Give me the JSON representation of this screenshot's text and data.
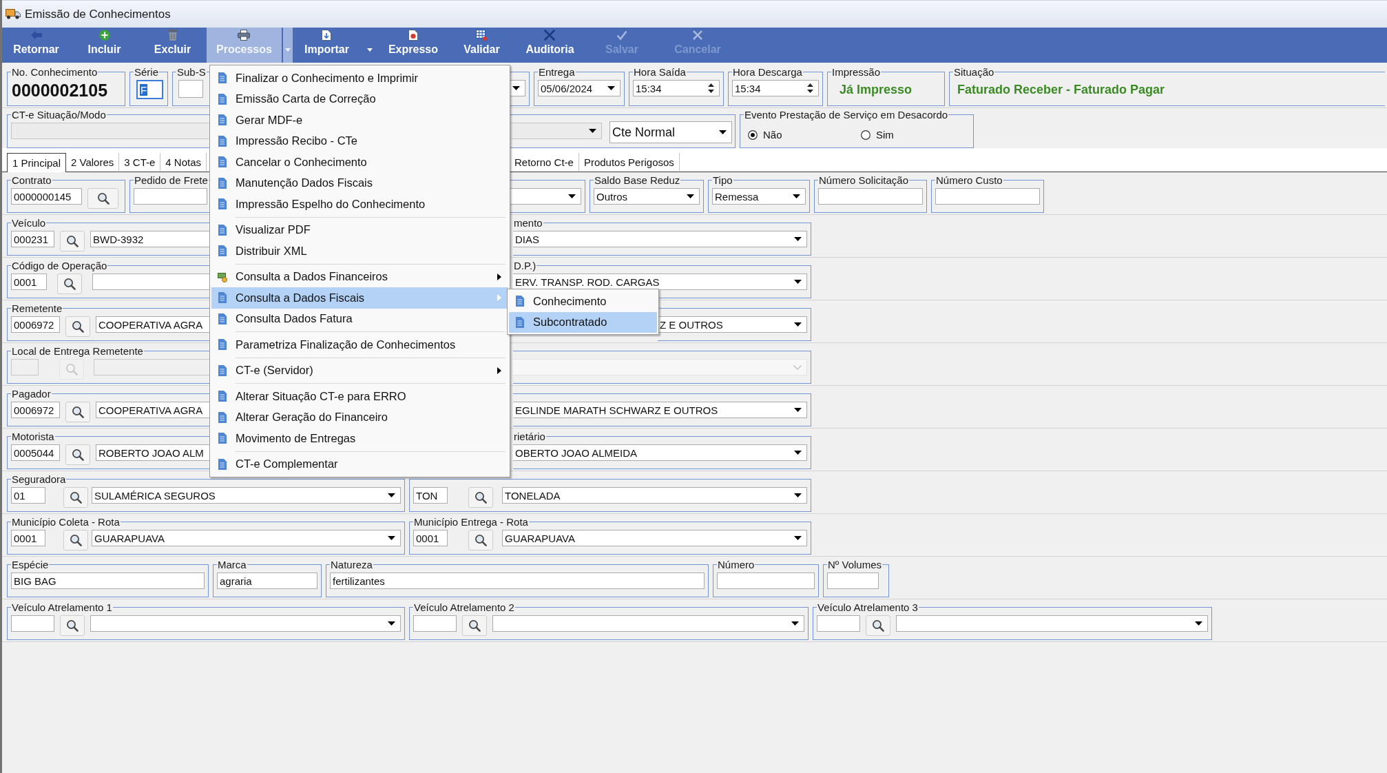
{
  "window": {
    "title": "Emissão de Conhecimentos"
  },
  "toolbar": [
    {
      "label": "Retornar",
      "selected": false,
      "disabled": false,
      "dropdown": false
    },
    {
      "label": "Incluir",
      "selected": false,
      "disabled": false,
      "dropdown": false
    },
    {
      "label": "Excluir",
      "selected": false,
      "disabled": false,
      "dropdown": false
    },
    {
      "label": "Processos",
      "selected": true,
      "disabled": false,
      "dropdown": true
    },
    {
      "label": "Importar",
      "selected": false,
      "disabled": false,
      "dropdown": true
    },
    {
      "label": "Expresso",
      "selected": false,
      "disabled": false,
      "dropdown": false
    },
    {
      "label": "Validar",
      "selected": false,
      "disabled": false,
      "dropdown": false
    },
    {
      "label": "Auditoria",
      "selected": false,
      "disabled": false,
      "dropdown": false
    },
    {
      "label": "Salvar",
      "selected": false,
      "disabled": true,
      "dropdown": false
    },
    {
      "label": "Cancelar",
      "selected": false,
      "disabled": true,
      "dropdown": false
    }
  ],
  "header": [
    {
      "groups": [
        {
          "label": "No. Conhecimento",
          "fields": [
            {
              "kind": "display",
              "value": "0000002105"
            }
          ]
        },
        {
          "label": "Série",
          "fields": [
            {
              "kind": "text",
              "value": "F",
              "focused": true,
              "disabled": false
            }
          ]
        },
        {
          "label": "Sub-S",
          "fields": [
            {
              "kind": "text",
              "focused": false,
              "disabled": false
            }
          ]
        },
        {
          "fields": [
            {
              "kind": "combo",
              "disabled": false,
              "readonly": false
            }
          ]
        },
        {
          "label": "Entrega",
          "fields": [
            {
              "kind": "combo",
              "value": "05/06/2024",
              "disabled": false,
              "readonly": false
            }
          ]
        },
        {
          "label": "Hora Saída",
          "fields": [
            {
              "kind": "spin",
              "value": "15:34"
            }
          ]
        },
        {
          "label": "Hora Descarga",
          "fields": [
            {
              "kind": "spin",
              "value": "15:34"
            }
          ]
        },
        {
          "label": "Impressão",
          "fields": [
            {
              "kind": "status",
              "value": "Já Impresso"
            }
          ]
        },
        {
          "label": "Situação",
          "fields": [
            {
              "kind": "status",
              "value": "Faturado Receber - Faturado Pagar"
            }
          ]
        }
      ]
    },
    {
      "groups": [
        {
          "label": "CT-e Situação/Modo",
          "fields": [
            {
              "kind": "combo",
              "disabled": false,
              "readonly": true
            },
            {
              "kind": "combo",
              "value": "Cte Normal",
              "disabled": false,
              "readonly": false
            }
          ]
        },
        {
          "label": "Evento Prestação de Serviço em Desacordo",
          "fields": [
            {
              "kind": "radio",
              "label": "Não",
              "selected": true
            },
            {
              "kind": "radio",
              "label": "Sim",
              "selected": false
            }
          ]
        }
      ]
    }
  ],
  "tabs": [
    {
      "label": "1 Principal",
      "selected": true
    },
    {
      "label": "2 Valores",
      "selected": false
    },
    {
      "label": "3 CT-e",
      "selected": false
    },
    {
      "label": "4 Notas",
      "selected": false
    },
    {
      "label": "Retorno Ct-e",
      "selected": false
    },
    {
      "label": "Produtos Perigosos",
      "selected": false
    }
  ],
  "principal": [
    {
      "groups": [
        {
          "label": "Contrato",
          "fields": [
            {
              "kind": "text",
              "value": "0000000145",
              "disabled": false
            },
            {
              "kind": "lookup",
              "disabled": false
            }
          ]
        },
        {
          "label": "Pedido de Frete",
          "fields": [
            {
              "kind": "text",
              "disabled": false
            }
          ]
        },
        {
          "fields": [
            {
              "kind": "combo",
              "disabled": false
            }
          ]
        },
        {
          "label": "Saldo Base Reduz",
          "fields": [
            {
              "kind": "combo",
              "value": "Outros",
              "disabled": false
            }
          ]
        },
        {
          "label": "Tipo",
          "fields": [
            {
              "kind": "combo",
              "value": "Remessa",
              "disabled": false
            }
          ]
        },
        {
          "label": "Número Solicitação",
          "fields": [
            {
              "kind": "text",
              "disabled": false
            }
          ]
        },
        {
          "label": "Número Custo",
          "fields": [
            {
              "kind": "text",
              "disabled": false
            }
          ]
        }
      ]
    },
    {
      "groups": [
        {
          "label": "Veículo",
          "fields": [
            {
              "kind": "text",
              "value": "000231",
              "disabled": false
            },
            {
              "kind": "lookup",
              "disabled": false
            },
            {
              "kind": "text",
              "value": "BWD-3932",
              "disabled": false
            }
          ]
        },
        {
          "label": "mento",
          "fields": [
            {
              "kind": "combo",
              "value": "DIAS",
              "disabled": false
            }
          ]
        }
      ]
    },
    {
      "groups": [
        {
          "label": "Código de Operação",
          "fields": [
            {
              "kind": "text",
              "value": "0001",
              "disabled": false
            },
            {
              "kind": "lookup",
              "disabled": false
            },
            {
              "kind": "text",
              "disabled": false
            }
          ]
        },
        {
          "label": "D.P.)",
          "fields": [
            {
              "kind": "combo",
              "value": "ERV. TRANSP. ROD. CARGAS",
              "disabled": false
            }
          ]
        }
      ]
    },
    {
      "groups": [
        {
          "label": "Remetente",
          "fields": [
            {
              "kind": "text",
              "value": "0006972",
              "disabled": false
            },
            {
              "kind": "lookup",
              "disabled": false
            },
            {
              "kind": "text",
              "value": "COOPERATIVA AGRA",
              "disabled": false
            }
          ]
        },
        {
          "fields": [
            {
              "kind": "combo",
              "value": "Z E OUTROS",
              "disabled": false
            }
          ]
        }
      ]
    },
    {
      "groups": [
        {
          "label": "Local de Entrega Remetente",
          "fields": [
            {
              "kind": "text",
              "disabled": true
            },
            {
              "kind": "lookup",
              "disabled": true
            },
            {
              "kind": "text",
              "disabled": true
            }
          ]
        },
        {
          "fields": [
            {
              "kind": "combo",
              "disabled": true
            }
          ]
        }
      ]
    },
    {
      "groups": [
        {
          "label": "Pagador",
          "fields": [
            {
              "kind": "text",
              "value": "0006972",
              "disabled": false
            },
            {
              "kind": "lookup",
              "disabled": false
            },
            {
              "kind": "text",
              "value": "COOPERATIVA AGRA",
              "disabled": false
            }
          ]
        },
        {
          "fields": [
            {
              "kind": "combo",
              "value": "EGLINDE MARATH SCHWARZ E OUTROS",
              "disabled": false
            }
          ]
        }
      ]
    },
    {
      "groups": [
        {
          "label": "Motorista",
          "fields": [
            {
              "kind": "text",
              "value": "0005044",
              "disabled": false
            },
            {
              "kind": "lookup",
              "disabled": false
            },
            {
              "kind": "text",
              "value": "ROBERTO JOAO ALM",
              "disabled": false
            }
          ]
        },
        {
          "label": "rietário",
          "fields": [
            {
              "kind": "combo",
              "value": "OBERTO JOAO ALMEIDA",
              "disabled": false
            }
          ]
        }
      ]
    },
    {
      "groups": [
        {
          "label": "Seguradora",
          "fields": [
            {
              "kind": "text",
              "value": "01",
              "disabled": false
            },
            {
              "kind": "lookup",
              "disabled": false
            },
            {
              "kind": "combo",
              "value": "SULAMÉRICA SEGUROS",
              "disabled": false
            }
          ]
        },
        {
          "fields": [
            {
              "kind": "text",
              "value": "TON",
              "disabled": false
            },
            {
              "kind": "lookup",
              "disabled": false
            },
            {
              "kind": "combo",
              "value": "TONELADA",
              "disabled": false
            }
          ]
        }
      ]
    },
    {
      "groups": [
        {
          "label": "Município Coleta - Rota",
          "fields": [
            {
              "kind": "text",
              "value": "0001",
              "disabled": false
            },
            {
              "kind": "lookup",
              "disabled": false
            },
            {
              "kind": "combo",
              "value": "GUARAPUAVA",
              "disabled": false
            }
          ]
        },
        {
          "label": "Município Entrega - Rota",
          "fields": [
            {
              "kind": "text",
              "value": "0001",
              "disabled": false
            },
            {
              "kind": "lookup",
              "disabled": false
            },
            {
              "kind": "combo",
              "value": "GUARAPUAVA",
              "disabled": false
            }
          ]
        }
      ]
    },
    {
      "groups": [
        {
          "label": "Espécie",
          "fields": [
            {
              "kind": "text",
              "value": "BIG BAG",
              "disabled": false
            }
          ]
        },
        {
          "label": "Marca",
          "fields": [
            {
              "kind": "text",
              "value": "agraria",
              "disabled": false
            }
          ]
        },
        {
          "label": "Natureza",
          "fields": [
            {
              "kind": "text",
              "value": "fertilizantes",
              "disabled": false
            }
          ]
        },
        {
          "label": "Número",
          "fields": [
            {
              "kind": "text",
              "disabled": false
            }
          ]
        },
        {
          "label": "Nº Volumes",
          "fields": [
            {
              "kind": "text",
              "disabled": false
            }
          ]
        }
      ]
    },
    {
      "groups": [
        {
          "label": "Veículo Atrelamento 1",
          "fields": [
            {
              "kind": "text",
              "disabled": false
            },
            {
              "kind": "lookup",
              "disabled": false
            },
            {
              "kind": "combo",
              "disabled": false
            }
          ]
        },
        {
          "label": "Veículo Atrelamento 2",
          "fields": [
            {
              "kind": "text",
              "disabled": false
            },
            {
              "kind": "lookup",
              "disabled": false
            },
            {
              "kind": "combo",
              "disabled": false
            }
          ]
        },
        {
          "label": "Veículo Atrelamento 3",
          "fields": [
            {
              "kind": "text",
              "disabled": false
            },
            {
              "kind": "lookup",
              "disabled": false
            },
            {
              "kind": "combo",
              "disabled": false
            }
          ]
        }
      ]
    }
  ],
  "menu": {
    "items": [
      {
        "kind": "item",
        "label": "Finalizar o Conhecimento e Imprimir",
        "selected": false,
        "submenu": false
      },
      {
        "kind": "item",
        "label": "Emissão Carta de Correção",
        "selected": false,
        "submenu": false
      },
      {
        "kind": "item",
        "label": "Gerar MDF-e",
        "selected": false,
        "submenu": false
      },
      {
        "kind": "item",
        "label": "Impressão Recibo - CTe",
        "selected": false,
        "submenu": false
      },
      {
        "kind": "item",
        "label": "Cancelar o Conhecimento",
        "selected": false,
        "submenu": false
      },
      {
        "kind": "item",
        "label": "Manutenção Dados Fiscais",
        "selected": false,
        "submenu": false
      },
      {
        "kind": "item",
        "label": "Impressão Espelho do Conhecimento",
        "selected": false,
        "submenu": false
      },
      {
        "kind": "separator"
      },
      {
        "kind": "item",
        "label": "Visualizar PDF",
        "selected": false,
        "submenu": false
      },
      {
        "kind": "item",
        "label": "Distribuir XML",
        "selected": false,
        "submenu": false
      },
      {
        "kind": "separator"
      },
      {
        "kind": "item",
        "label": "Consulta a Dados Financeiros",
        "selected": false,
        "submenu": true
      },
      {
        "kind": "item",
        "label": "Consulta a Dados Fiscais",
        "selected": true,
        "submenu": true,
        "children": [
          {
            "label": "Conhecimento",
            "selected": false
          },
          {
            "label": "Subcontratado",
            "selected": true
          }
        ]
      },
      {
        "kind": "item",
        "label": "Consulta Dados Fatura",
        "selected": false,
        "submenu": false
      },
      {
        "kind": "separator"
      },
      {
        "kind": "item",
        "label": "Parametriza Finalização de Conhecimentos",
        "selected": false,
        "submenu": false
      },
      {
        "kind": "separator"
      },
      {
        "kind": "item",
        "label": "CT-e (Servidor)",
        "selected": false,
        "submenu": true
      },
      {
        "kind": "separator"
      },
      {
        "kind": "item",
        "label": "Alterar Situação CT-e para ERRO",
        "selected": false,
        "submenu": false
      },
      {
        "kind": "item",
        "label": "Alterar Geração do Financeiro",
        "selected": false,
        "submenu": false
      },
      {
        "kind": "item",
        "label": "Movimento de Entregas",
        "selected": false,
        "submenu": false
      },
      {
        "kind": "separator"
      },
      {
        "kind": "item",
        "label": "CT-e Complementar",
        "selected": false,
        "submenu": false
      }
    ]
  }
}
